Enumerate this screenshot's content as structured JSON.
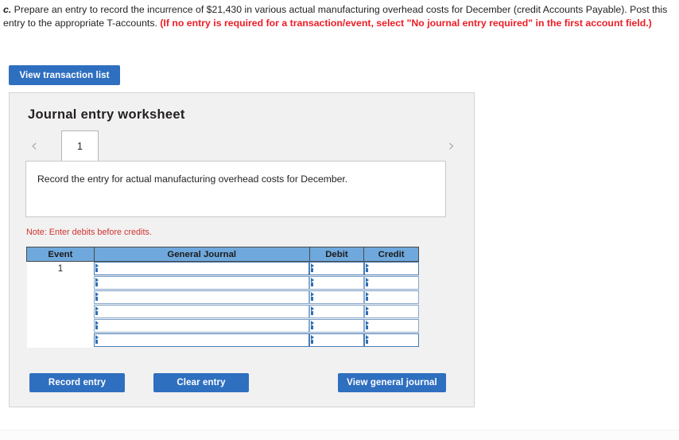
{
  "question": {
    "lead": "c.",
    "body_1": " Prepare an entry to record the incurrence of $21,430 in various actual manufacturing overhead costs for December (credit Accounts Payable). Post this entry to the appropriate T-accounts. ",
    "alert": "(If no entry is required for a transaction/event, select \"No journal entry required\" in the first account field.)"
  },
  "toolbar": {
    "view_transaction_list_label": "View transaction list"
  },
  "panel": {
    "title": "Journal entry worksheet",
    "tabs": {
      "prev_icon": "chevron-left-icon",
      "next_icon": "chevron-right-icon",
      "items": [
        {
          "label": "1",
          "selected": true
        }
      ]
    },
    "instruction": "Record the entry for actual manufacturing overhead costs for December.",
    "note": "Note: Enter debits before credits.",
    "table": {
      "columns": [
        "Event",
        "General Journal",
        "Debit",
        "Credit"
      ],
      "rows": [
        {
          "event": "1",
          "general_journal": "",
          "debit": "",
          "credit": ""
        },
        {
          "event": "",
          "general_journal": "",
          "debit": "",
          "credit": ""
        },
        {
          "event": "",
          "general_journal": "",
          "debit": "",
          "credit": ""
        },
        {
          "event": "",
          "general_journal": "",
          "debit": "",
          "credit": ""
        },
        {
          "event": "",
          "general_journal": "",
          "debit": "",
          "credit": ""
        },
        {
          "event": "",
          "general_journal": "",
          "debit": "",
          "credit": ""
        }
      ]
    },
    "buttons": {
      "record_entry_label": "Record entry",
      "clear_entry_label": "Clear entry",
      "view_general_journal_label": "View general journal"
    }
  },
  "colors": {
    "button_blue": "#2f6fc0",
    "table_header_blue": "#6fa8dc",
    "alert_red": "#ee1c25",
    "note_red": "#d0332f",
    "panel_bg": "#f1f1f1"
  }
}
